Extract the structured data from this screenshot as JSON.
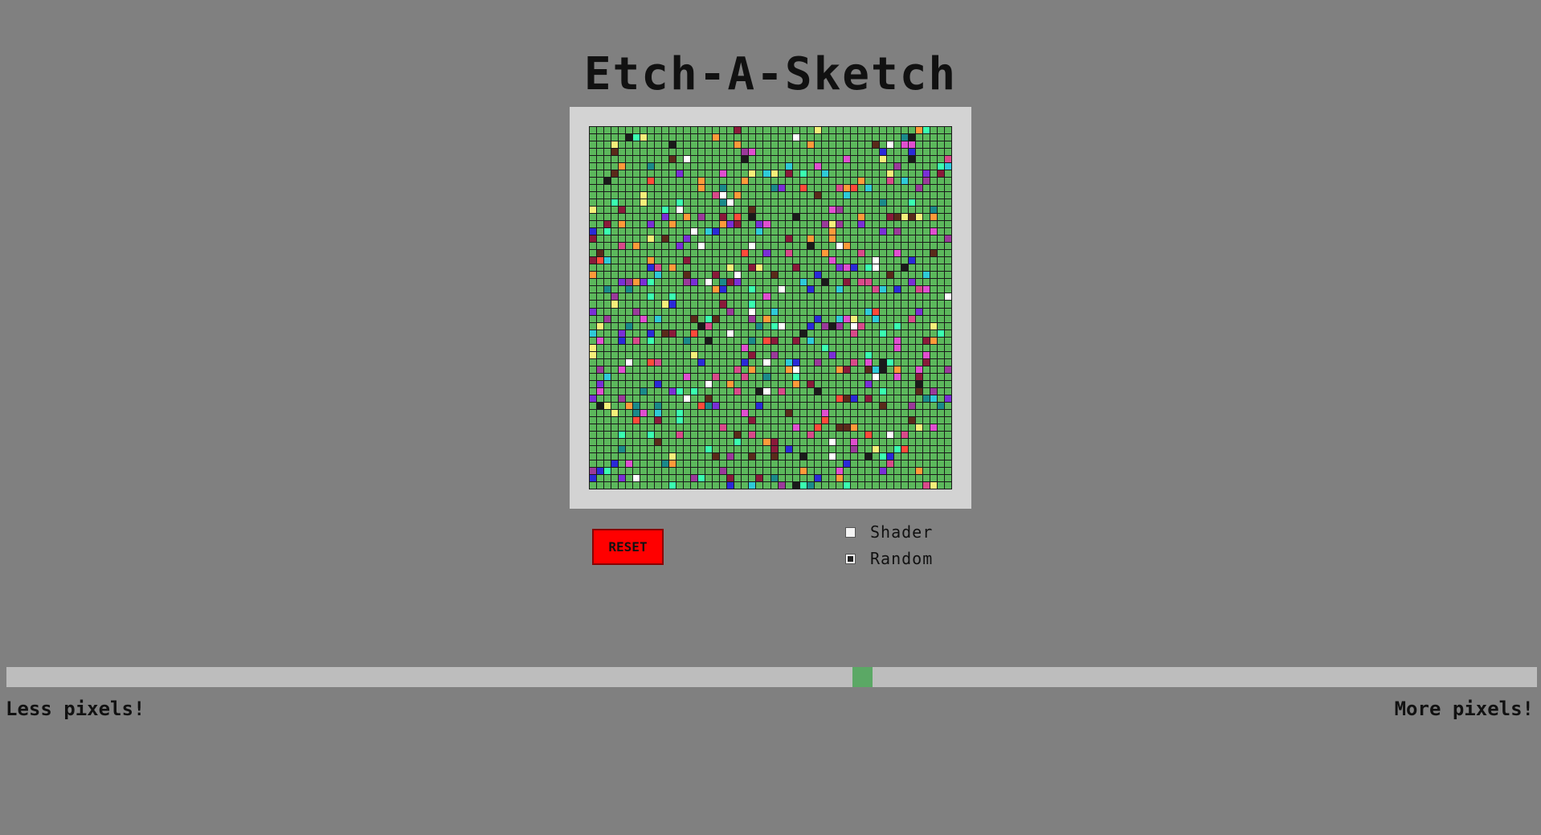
{
  "app": {
    "title": "Etch-A-Sketch"
  },
  "board": {
    "grid_size": 50,
    "base_color": "#5cb85c",
    "line_color": "#1a1a1a",
    "frame_color": "#d3d3d3",
    "painted_palette": [
      "#7a2fd6",
      "#e04fd0",
      "#2ecad8",
      "#1a1a1a",
      "#f5f07a",
      "#ff4a3a",
      "#2a2ad8",
      "#8a1a3a",
      "#ff9a3a",
      "#ffffff",
      "#3affb0",
      "#9a3a9a",
      "#d84a8a",
      "#5a2a1a",
      "#1a8a8a"
    ]
  },
  "controls": {
    "reset_label": "RESET",
    "shader_label": "Shader",
    "shader_checked": false,
    "random_label": "Random",
    "random_checked": true
  },
  "slider": {
    "value_fraction": 0.56,
    "left_label": "Less pixels!",
    "right_label": "More pixels!"
  }
}
